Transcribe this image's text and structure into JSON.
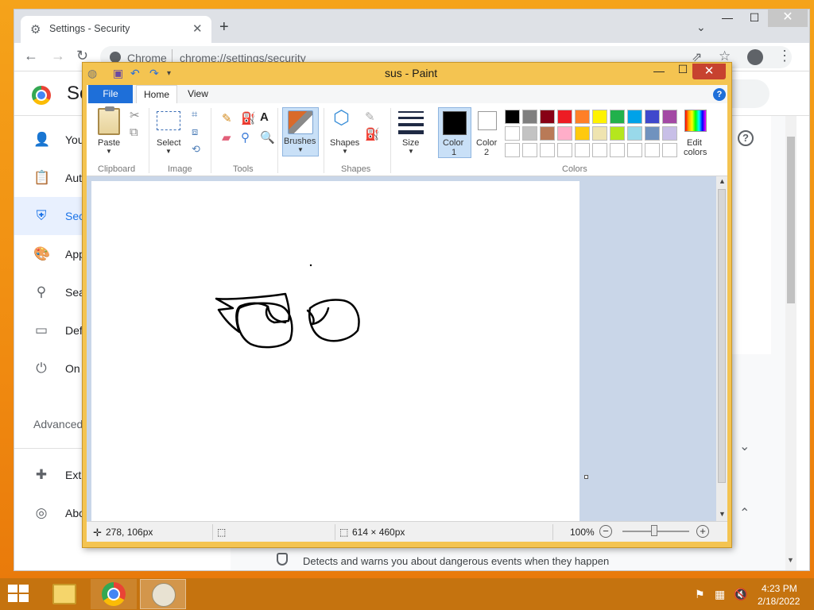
{
  "chrome": {
    "tab_title": "Settings - Security",
    "omnibox_site": "Chrome",
    "omnibox_url": "chrome://settings/security",
    "page_title": "Se",
    "sidebar": [
      {
        "label": "You",
        "icon": "person-icon"
      },
      {
        "label": "Aut",
        "icon": "clipboard-icon"
      },
      {
        "label": "Sec",
        "icon": "shield-icon",
        "active": true
      },
      {
        "label": "App",
        "icon": "palette-icon"
      },
      {
        "label": "Sea",
        "icon": "search-icon"
      },
      {
        "label": "Def",
        "icon": "browser-icon"
      },
      {
        "label": "On",
        "icon": "power-icon"
      }
    ],
    "advanced_label": "Advanced",
    "sidebar_bottom": [
      {
        "label": "Ext",
        "icon": "puzzle-icon"
      },
      {
        "label": "Abo",
        "icon": "chrome-icon"
      }
    ],
    "row_text": "Detects and warns you about dangerous events when they happen",
    "help_glyph": "?"
  },
  "paint": {
    "title": "sus - Paint",
    "tabs": {
      "file": "File",
      "home": "Home",
      "view": "View"
    },
    "ribbon": {
      "paste": "Paste",
      "select": "Select",
      "brushes": "Brushes",
      "shapes": "Shapes",
      "size": "Size",
      "color1_line1": "Color",
      "color1_line2": "1",
      "color2_line1": "Color",
      "color2_line2": "2",
      "edit_colors_line1": "Edit",
      "edit_colors_line2": "colors",
      "groups": {
        "clipboard": "Clipboard",
        "image": "Image",
        "tools": "Tools",
        "shapes": "Shapes",
        "colors": "Colors"
      }
    },
    "palette_row1": [
      "#000000",
      "#7f7f7f",
      "#880015",
      "#ed1c24",
      "#ff7f27",
      "#fff200",
      "#22b14c",
      "#00a2e8",
      "#3f48cc",
      "#a349a4"
    ],
    "palette_row2": [
      "#ffffff",
      "#c3c3c3",
      "#b97a57",
      "#ffaec9",
      "#ffc90e",
      "#efe4b0",
      "#b5e61d",
      "#99d9ea",
      "#7092be",
      "#c8bfe7"
    ],
    "palette_row3": [
      "#ffffff",
      "#ffffff",
      "#ffffff",
      "#ffffff",
      "#ffffff",
      "#ffffff",
      "#ffffff",
      "#ffffff",
      "#ffffff",
      "#ffffff"
    ],
    "status": {
      "cursor_pos": "278, 106px",
      "image_size": "614 × 460px",
      "zoom": "100%"
    }
  },
  "taskbar": {
    "time": "4:23 PM",
    "date": "2/18/2022"
  }
}
